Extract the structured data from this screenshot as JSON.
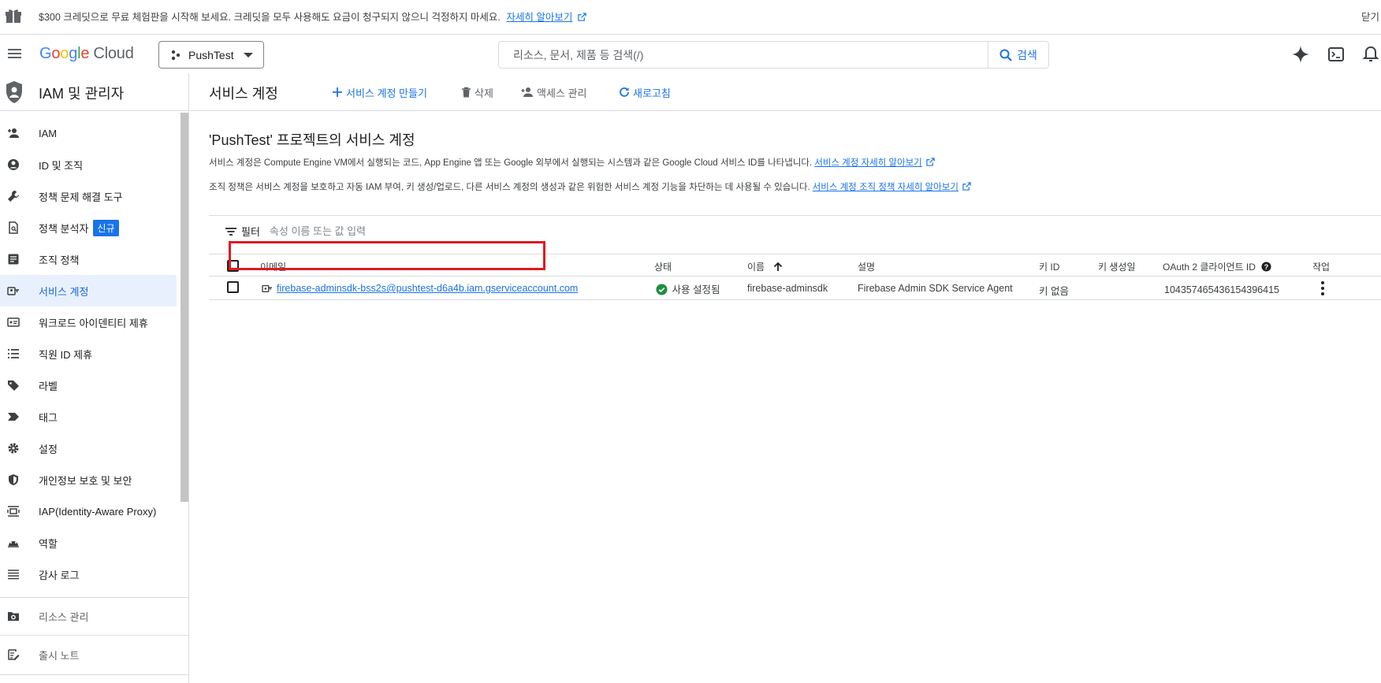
{
  "banner": {
    "text": "$300 크레딧으로 무료 체험판을 시작해 보세요. 크레딧을 모두 사용해도 요금이 청구되지 않으니 걱정하지 마세요.",
    "link": "자세히 알아보기",
    "close": "닫기"
  },
  "topbar": {
    "logo_letters": [
      "G",
      "o",
      "o",
      "g",
      "l",
      "e"
    ],
    "logo_product": "Cloud",
    "project_name": "PushTest",
    "search_placeholder": "리소스, 문서, 제품 등 검색(/)",
    "search_button": "검색"
  },
  "sidebar": {
    "title": "IAM 및 관리자",
    "items": [
      {
        "label": "IAM",
        "icon": "person-add-icon"
      },
      {
        "label": "ID 및 조직",
        "icon": "account-circle-icon"
      },
      {
        "label": "정책 문제 해결 도구",
        "icon": "wrench-icon"
      },
      {
        "label": "정책 분석자",
        "icon": "document-search-icon",
        "badge": "신규"
      },
      {
        "label": "조직 정책",
        "icon": "article-icon"
      },
      {
        "label": "서비스 계정",
        "icon": "service-account-icon",
        "active": true
      },
      {
        "label": "워크로드 아이덴티티 제휴",
        "icon": "id-card-icon"
      },
      {
        "label": "직원 ID 제휴",
        "icon": "list-icon"
      },
      {
        "label": "라벨",
        "icon": "label-icon"
      },
      {
        "label": "태그",
        "icon": "tag-icon"
      },
      {
        "label": "설정",
        "icon": "gear-icon"
      },
      {
        "label": "개인정보 보호 및 보안",
        "icon": "shield-icon"
      },
      {
        "label": "IAP(Identity-Aware Proxy)",
        "icon": "iap-icon"
      },
      {
        "label": "역할",
        "icon": "roles-icon"
      },
      {
        "label": "감사 로그",
        "icon": "audit-log-icon"
      }
    ],
    "resource_manage": "리소스 관리",
    "release_notes": "출시 노트"
  },
  "main": {
    "page_title": "서비스 계정",
    "actions": {
      "create": "서비스 계정 만들기",
      "delete": "삭제",
      "manage_access": "액세스 관리",
      "refresh": "새로고침"
    },
    "section_title": "'PushTest' 프로젝트의 서비스 계정",
    "desc1": "서비스 계정은 Compute Engine VM에서 실행되는 코드, App Engine 앱 또는 Google 외부에서 실행되는 시스템과 같은 Google Cloud 서비스 ID를 나타냅니다.",
    "desc1_link": "서비스 계정 자세히 알아보기",
    "desc2": "조직 정책은 서비스 계정을 보호하고 자동 IAM 부여, 키 생성/업로드, 다른 서비스 계정의 생성과 같은 위험한 서비스 계정 기능을 차단하는 데 사용될 수 있습니다.",
    "desc2_link": "서비스 계정 조직 정책 자세히 알아보기",
    "filter_label": "필터",
    "filter_placeholder": "속성 이름 또는 값 입력",
    "columns": {
      "email": "이메일",
      "status": "상태",
      "name": "이름",
      "description": "설명",
      "key_id": "키 ID",
      "key_created": "키 생성일",
      "oauth": "OAuth 2 클라이언트 ID",
      "actions": "작업"
    },
    "rows": [
      {
        "email": "firebase-adminsdk-bss2s@pushtest-d6a4b.iam.gserviceaccount.com",
        "status": "사용 설정됨",
        "name": "firebase-adminsdk",
        "description": "Firebase Admin SDK Service Agent",
        "key_id": "키 없음",
        "key_created": "",
        "oauth": "104357465436154396415"
      }
    ]
  },
  "colors": {
    "accent": "#1a73e8",
    "active_bg": "#e8f0fe",
    "highlight": "#e01a22",
    "status_ok": "#1e8e3e"
  }
}
